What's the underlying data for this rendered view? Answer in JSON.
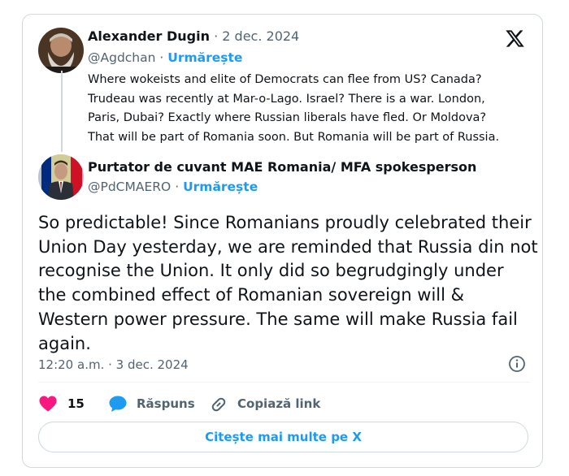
{
  "quoted_tweet": {
    "author_name": "Alexander Dugin",
    "separator": "·",
    "date": "2 dec. 2024",
    "handle": "@Agdchan",
    "follow_label": "Urmărește",
    "text_lines": [
      "Where wokeists and elite of Democrats can flee from US? Canada?",
      "Trudeau was recently at Mar-o-Lago. Israel? There is a war. London,",
      "Paris, Dubai? Exactly where Russian liberals have fled. Or Moldova?",
      "That will be part of Romania soon. But Romania will be part of Russia."
    ]
  },
  "main_tweet": {
    "author_name": "Purtator de cuvant MAE Romania/ MFA spokesperson",
    "handle": "@PdCMAERO",
    "separator": "·",
    "follow_label": "Urmărește",
    "text_lines": [
      "So predictable! Since Romanians proudly celebrated their",
      "Union Day yesterday, we are reminded that Russia din not",
      "recognise the Union. It only did so begrudgingly under",
      "the combined effect of Romanian sovereign will &",
      "Western power pressure. The same will make Russia fail",
      "again."
    ],
    "timestamp": "12:20 a.m. · 3 dec. 2024"
  },
  "actions": {
    "like_count": "15",
    "reply_label": "Răspuns",
    "copy_link_label": "Copiază link"
  },
  "cta_label": "Citește mai multe pe X",
  "icons": {
    "platform": "x-logo-icon",
    "info": "info-icon",
    "like": "heart-icon",
    "reply": "speech-bubble-icon",
    "copy_link": "link-icon"
  },
  "colors": {
    "accent": "#1d9bf0",
    "like": "#f91880",
    "muted": "#536471",
    "border": "#cfd9de"
  }
}
